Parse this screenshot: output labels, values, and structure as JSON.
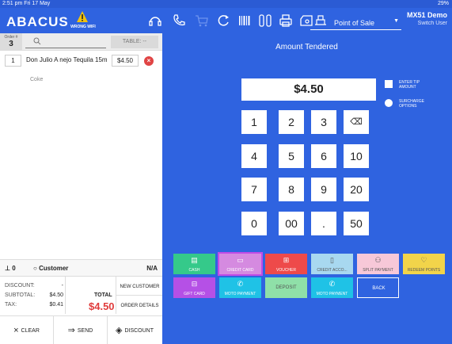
{
  "status": {
    "time": "2:51 pm  Fri 17 May",
    "battery": "29%"
  },
  "header": {
    "logo": "ABACUS",
    "warning_label": "WRONG WIFI",
    "pos_label": "Point of Sale",
    "user_name": "MX51 Demo",
    "user_sub": "Switch User"
  },
  "order": {
    "number_label": "Order #",
    "number": "3",
    "table": "TABLE: --",
    "items": [
      {
        "qty": "1",
        "name": "Don Julio A nejo Tequila 15m",
        "price": "$4.50",
        "sub": "Coke"
      }
    ],
    "customer_count": "0",
    "customer_label": "Customer",
    "customer_value": "N/A"
  },
  "totals": {
    "discount_label": "DISCOUNT:",
    "discount": "-",
    "subtotal_label": "SUBTOTAL:",
    "subtotal": "$4.50",
    "tax_label": "TAX:",
    "tax": "$0.41",
    "total_label": "TOTAL",
    "total": "$4.50",
    "new_customer": "NEW CUSTOMER",
    "order_details": "ORDER DETAILS"
  },
  "actions": {
    "clear": "CLEAR",
    "send": "SEND",
    "discount": "DISCOUNT"
  },
  "payment": {
    "title": "Amount Tendered",
    "amount": "$4.50",
    "keypad": [
      "1",
      "2",
      "3",
      "4",
      "5",
      "6",
      "10",
      "7",
      "8",
      "9",
      "20",
      "0",
      "00",
      ".",
      "50"
    ],
    "options": [
      {
        "label_1": "ENTER TIP",
        "label_2": "AMOUNT"
      },
      {
        "label_1": "SURCHARGE",
        "label_2": "OPTIONS"
      }
    ],
    "methods": [
      {
        "label": "CASH",
        "color": "#35c98a",
        "icon": "cash-icon"
      },
      {
        "label": "CREDIT CARD",
        "color": "#d58ae0",
        "icon": "credit-card-icon",
        "selected": true
      },
      {
        "label": "VOUCHER",
        "color": "#ee4a4a",
        "icon": "gift-icon"
      },
      {
        "label": "CREDIT ACCO...",
        "color": "#a8d8f0",
        "icon": "document-icon"
      },
      {
        "label": "SPLIT PAYMENT",
        "color": "#f7c8d8",
        "icon": "people-icon"
      },
      {
        "label": "REDEEM POINTS",
        "color": "#f2d44a",
        "icon": "heart-icon"
      },
      {
        "label": "GIFT CARD",
        "color": "#b550e6",
        "icon": "gift-card-icon"
      },
      {
        "label": "MOTO PAYMENT",
        "color": "#1fc2e6",
        "icon": "phone-icon"
      },
      {
        "label": "DEPOSIT",
        "color": "#8fe0a8",
        "icon": ""
      },
      {
        "label": "MOTO PAYMENT",
        "color": "#1fc2e6",
        "icon": "phone-icon"
      },
      {
        "label": "BACK",
        "color": "#2f63e0",
        "icon": ""
      }
    ]
  }
}
